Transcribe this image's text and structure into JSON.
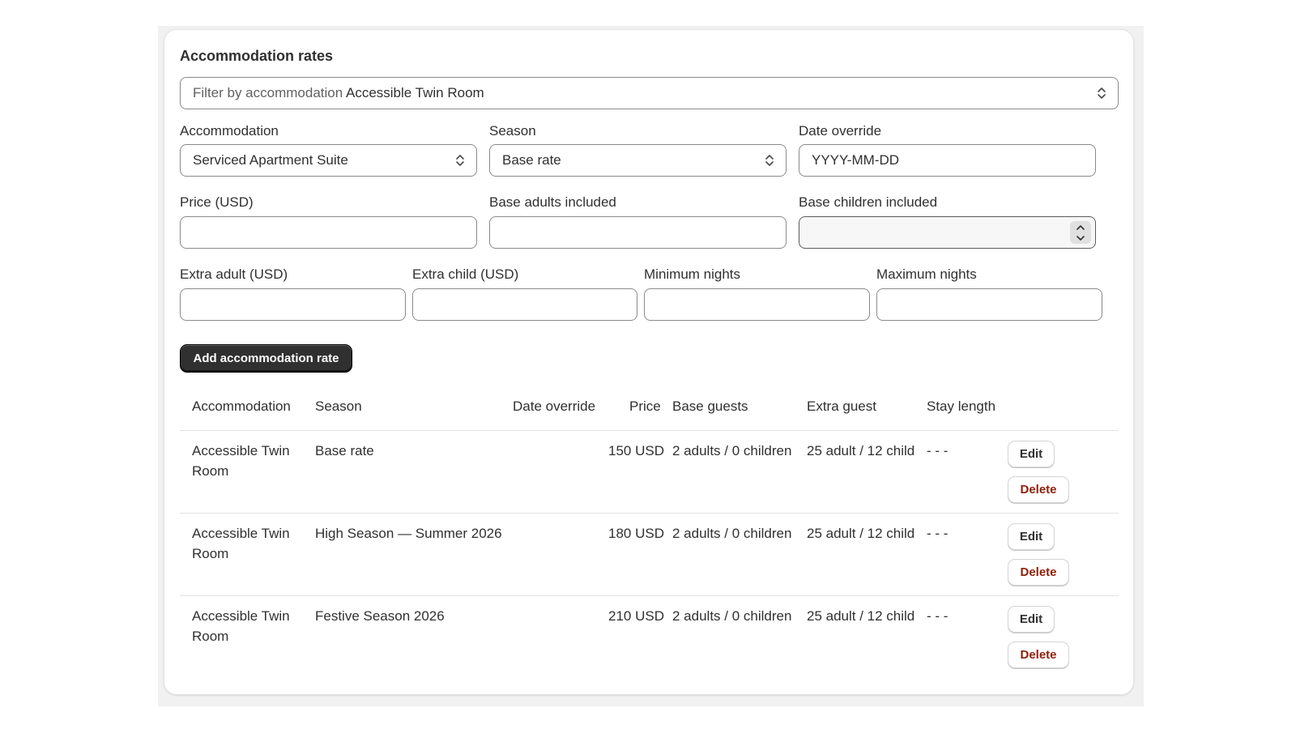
{
  "title": "Accommodation rates",
  "filter": {
    "label": "Filter by accommodation",
    "value": "Accessible Twin Room",
    "icon": "chevron-up-down-icon"
  },
  "form": {
    "accommodation": {
      "label": "Accommodation",
      "value": "Serviced Apartment Suite"
    },
    "season": {
      "label": "Season",
      "value": "Base rate"
    },
    "date_override": {
      "label": "Date override",
      "placeholder": "YYYY-MM-DD"
    },
    "price": {
      "label": "Price (USD)",
      "value": ""
    },
    "base_adults": {
      "label": "Base adults included",
      "value": ""
    },
    "base_children": {
      "label": "Base children included",
      "value": ""
    },
    "extra_adult": {
      "label": "Extra adult (USD)",
      "value": ""
    },
    "extra_child": {
      "label": "Extra child (USD)",
      "value": ""
    },
    "min_nights": {
      "label": "Minimum nights",
      "value": ""
    },
    "max_nights": {
      "label": "Maximum nights",
      "value": ""
    },
    "submit_label": "Add accommodation rate"
  },
  "table": {
    "headers": [
      "Accommodation",
      "Season",
      "Date override",
      "Price",
      "Base guests",
      "Extra guest",
      "Stay length"
    ],
    "rows": [
      {
        "accommodation": "Accessible Twin Room",
        "season": "Base rate",
        "date_override": "",
        "price": "150 USD",
        "base_guests": "2 adults / 0 children",
        "extra_guest": "25 adult / 12 child",
        "stay_length": "- - -"
      },
      {
        "accommodation": "Accessible Twin Room",
        "season": "High Season — Summer 2026",
        "date_override": "",
        "price": "180 USD",
        "base_guests": "2 adults / 0 children",
        "extra_guest": "25 adult / 12 child",
        "stay_length": "- - -"
      },
      {
        "accommodation": "Accessible Twin Room",
        "season": "Festive Season 2026",
        "date_override": "",
        "price": "210 USD",
        "base_guests": "2 adults / 0 children",
        "extra_guest": "25 adult / 12 child",
        "stay_length": "- - -"
      }
    ],
    "edit_label": "Edit",
    "delete_label": "Delete"
  },
  "colors": {
    "primary_button": "#303030",
    "delete_text": "#8e1f0b",
    "border": "#8a8a8a",
    "background": "#f1f1f1"
  }
}
